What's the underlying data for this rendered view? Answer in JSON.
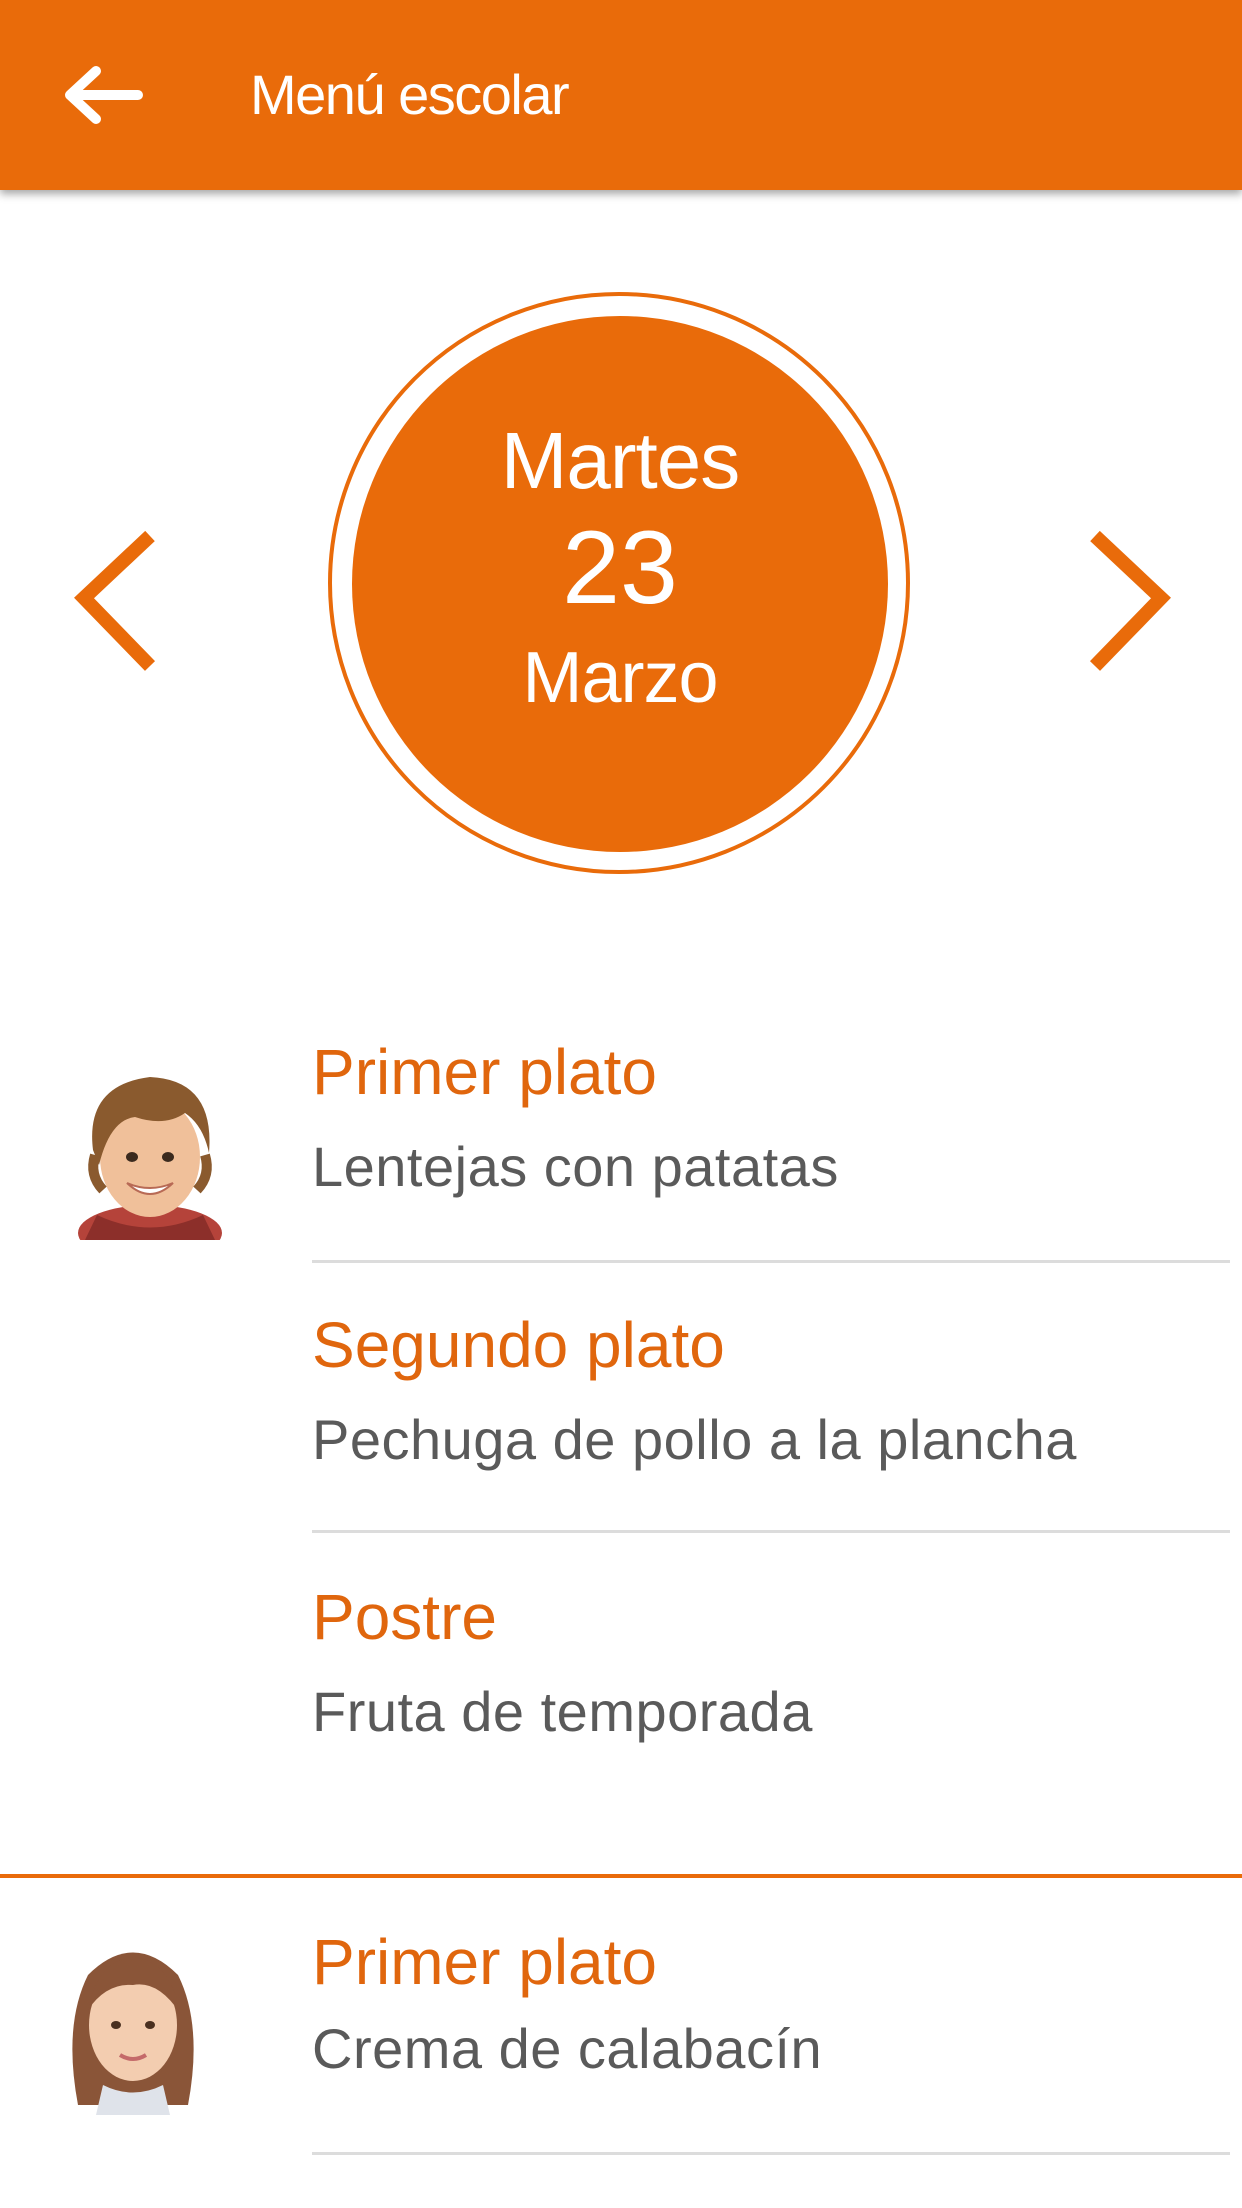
{
  "app_bar": {
    "title": "Menú escolar",
    "back_icon": "arrow-left-icon",
    "color": "#e96b0a"
  },
  "date": {
    "weekday": "Martes",
    "day": "23",
    "month": "Marzo",
    "prev_icon": "chevron-left-icon",
    "next_icon": "chevron-right-icon"
  },
  "children": [
    {
      "avatar": "child-boy-avatar",
      "dishes": [
        {
          "title": "Primer plato",
          "name": "Lentejas con patatas"
        },
        {
          "title": "Segundo plato",
          "name": "Pechuga de pollo a la plancha"
        },
        {
          "title": "Postre",
          "name": "Fruta de temporada"
        }
      ]
    },
    {
      "avatar": "child-girl-avatar",
      "dishes": [
        {
          "title": "Primer plato",
          "name": "Crema de calabacín"
        }
      ]
    }
  ]
}
